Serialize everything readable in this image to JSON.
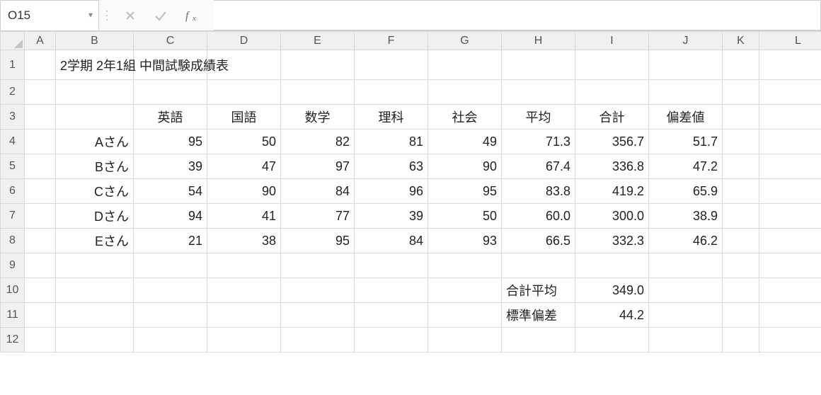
{
  "namebox": {
    "value": "O15"
  },
  "formula_bar": {
    "value": ""
  },
  "icons": {
    "cancel": "cancel-icon",
    "enter": "enter-icon",
    "fx": "fx-icon",
    "dropdown": "chevron-down-icon"
  },
  "columns": [
    "A",
    "B",
    "C",
    "D",
    "E",
    "F",
    "G",
    "H",
    "I",
    "J",
    "K",
    "L"
  ],
  "row_numbers": [
    "1",
    "2",
    "3",
    "4",
    "5",
    "6",
    "7",
    "8",
    "9",
    "10",
    "11",
    "12"
  ],
  "title": "2学期 2年1組 中間試験成績表",
  "headers": {
    "C": "英語",
    "D": "国語",
    "E": "数学",
    "F": "理科",
    "G": "社会",
    "H": "平均",
    "I": "合計",
    "J": "偏差値"
  },
  "students": [
    {
      "name": "Aさん",
      "eng": "95",
      "jpn": "50",
      "math": "82",
      "sci": "81",
      "soc": "49",
      "avg": "71.3",
      "sum": "356.7",
      "dev": "51.7"
    },
    {
      "name": "Bさん",
      "eng": "39",
      "jpn": "47",
      "math": "97",
      "sci": "63",
      "soc": "90",
      "avg": "67.4",
      "sum": "336.8",
      "dev": "47.2"
    },
    {
      "name": "Cさん",
      "eng": "54",
      "jpn": "90",
      "math": "84",
      "sci": "96",
      "soc": "95",
      "avg": "83.8",
      "sum": "419.2",
      "dev": "65.9"
    },
    {
      "name": "Dさん",
      "eng": "94",
      "jpn": "41",
      "math": "77",
      "sci": "39",
      "soc": "50",
      "avg": "60.0",
      "sum": "300.0",
      "dev": "38.9"
    },
    {
      "name": "Eさん",
      "eng": "21",
      "jpn": "38",
      "math": "95",
      "sci": "84",
      "soc": "93",
      "avg": "66.5",
      "sum": "332.3",
      "dev": "46.2"
    }
  ],
  "summary": {
    "row10": {
      "H": "合計平均",
      "I": "349.0"
    },
    "row11": {
      "H": "標準偏差",
      "I": "44.2"
    }
  }
}
